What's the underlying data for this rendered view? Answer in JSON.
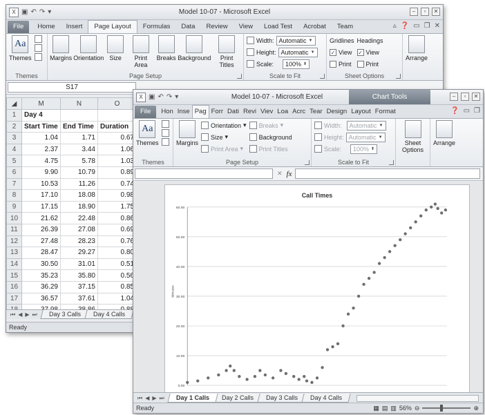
{
  "back_window": {
    "title": "Model 10-07 - Microsoft Excel",
    "tabs": [
      "File",
      "Home",
      "Insert",
      "Page Layout",
      "Formulas",
      "Data",
      "Review",
      "View",
      "Load Test",
      "Acrobat",
      "Team"
    ],
    "active_tab": "Page Layout",
    "ribbon": {
      "themes": {
        "button": "Themes",
        "label": "Themes"
      },
      "page_setup": {
        "buttons": [
          "Margins",
          "Orientation",
          "Size",
          "Print Area",
          "Breaks",
          "Background",
          "Print Titles"
        ],
        "label": "Page Setup"
      },
      "scale": {
        "width_label": "Width:",
        "width_value": "Automatic",
        "height_label": "Height:",
        "height_value": "Automatic",
        "scale_label": "Scale:",
        "scale_value": "100%",
        "label": "Scale to Fit"
      },
      "sheet_options": {
        "gridlines": "Gridlines",
        "headings": "Headings",
        "view": "View",
        "print": "Print",
        "label": "Sheet Options"
      },
      "arrange": {
        "button": "Arrange"
      }
    },
    "name_box": "S17",
    "columns": [
      "M",
      "N",
      "O"
    ],
    "rows": [
      {
        "n": "1",
        "cells": [
          "Day 4",
          "",
          ""
        ]
      },
      {
        "n": "2",
        "cells": [
          "Start Time",
          "End Time",
          "Duration"
        ]
      },
      {
        "n": "3",
        "cells": [
          "1.04",
          "1.71",
          "0.67"
        ]
      },
      {
        "n": "4",
        "cells": [
          "2.37",
          "3.44",
          "1.06"
        ]
      },
      {
        "n": "5",
        "cells": [
          "4.75",
          "5.78",
          "1.03"
        ]
      },
      {
        "n": "6",
        "cells": [
          "9.90",
          "10.79",
          "0.89"
        ]
      },
      {
        "n": "7",
        "cells": [
          "10.53",
          "11.26",
          "0.74"
        ]
      },
      {
        "n": "8",
        "cells": [
          "17.10",
          "18.08",
          "0.98"
        ]
      },
      {
        "n": "9",
        "cells": [
          "17.15",
          "18.90",
          "1.75"
        ]
      },
      {
        "n": "10",
        "cells": [
          "21.62",
          "22.48",
          "0.86"
        ]
      },
      {
        "n": "11",
        "cells": [
          "26.39",
          "27.08",
          "0.69"
        ]
      },
      {
        "n": "12",
        "cells": [
          "27.48",
          "28.23",
          "0.76"
        ]
      },
      {
        "n": "13",
        "cells": [
          "28.47",
          "29.27",
          "0.80"
        ]
      },
      {
        "n": "14",
        "cells": [
          "30.50",
          "31.01",
          "0.51"
        ]
      },
      {
        "n": "15",
        "cells": [
          "35.23",
          "35.80",
          "0.56"
        ]
      },
      {
        "n": "16",
        "cells": [
          "36.29",
          "37.15",
          "0.85"
        ]
      },
      {
        "n": "17",
        "cells": [
          "36.57",
          "37.61",
          "1.04"
        ]
      },
      {
        "n": "18",
        "cells": [
          "37.98",
          "38.86",
          "0.88"
        ]
      }
    ],
    "sheet_tabs": [
      "Day 3 Calls",
      "Day 4 Calls"
    ],
    "status": "Ready"
  },
  "front_window": {
    "title": "Model 10-07 - Microsoft Excel",
    "chart_tools": "Chart Tools",
    "tabs": [
      "File",
      "Hon",
      "Inse",
      "Pag",
      "Forr",
      "Dati",
      "Revi",
      "Viev",
      "Loa",
      "Acrc",
      "Tear",
      "Design",
      "Layout",
      "Format"
    ],
    "active_tab": "Pag",
    "ribbon": {
      "themes": {
        "button": "Themes",
        "label": "Themes"
      },
      "margins": "Margins",
      "orientation": "Orientation",
      "size": "Size",
      "print_area": "Print Area",
      "breaks": "Breaks",
      "background": "Background",
      "print_titles": "Print Titles",
      "page_setup_label": "Page Setup",
      "width_label": "Width:",
      "width_value": "Automatic",
      "height_label": "Height:",
      "height_value": "Automatic",
      "scale_label": "Scale:",
      "scale_value": "100%",
      "scale_group_label": "Scale to Fit",
      "sheet_options": "Sheet Options",
      "arrange": "Arrange"
    },
    "formula_fx": "fx",
    "sheet_tabs": [
      "Day 1 Calls",
      "Day 2 Calls",
      "Day 3 Calls",
      "Day 4 Calls"
    ],
    "active_sheet": "Day 1 Calls",
    "status": "Ready",
    "zoom": "56%"
  },
  "chart_data": {
    "type": "scatter",
    "title": "Call Times",
    "ylabel": "Minutes",
    "xlabel": "",
    "y_ticks": [
      "0.00",
      "10.00",
      "20.00",
      "30.00",
      "40.00",
      "50.00",
      "60.00"
    ],
    "ylim": [
      0,
      60
    ],
    "xlim": [
      0,
      1000
    ],
    "grid": true,
    "color": "#6e6e6e",
    "points": [
      [
        0,
        1
      ],
      [
        40,
        1.5
      ],
      [
        80,
        2.5
      ],
      [
        120,
        3.5
      ],
      [
        150,
        5
      ],
      [
        165,
        6.5
      ],
      [
        180,
        5
      ],
      [
        200,
        3
      ],
      [
        230,
        2
      ],
      [
        260,
        3
      ],
      [
        280,
        5
      ],
      [
        300,
        3.5
      ],
      [
        330,
        2.5
      ],
      [
        360,
        5
      ],
      [
        380,
        4
      ],
      [
        410,
        3
      ],
      [
        430,
        2
      ],
      [
        450,
        3
      ],
      [
        460,
        1.5
      ],
      [
        480,
        1
      ],
      [
        500,
        2.5
      ],
      [
        520,
        6
      ],
      [
        540,
        12
      ],
      [
        560,
        13
      ],
      [
        580,
        14
      ],
      [
        600,
        20
      ],
      [
        620,
        24
      ],
      [
        640,
        26
      ],
      [
        660,
        30
      ],
      [
        680,
        34
      ],
      [
        700,
        36
      ],
      [
        720,
        38
      ],
      [
        740,
        41
      ],
      [
        760,
        43
      ],
      [
        780,
        45
      ],
      [
        800,
        47
      ],
      [
        820,
        49
      ],
      [
        840,
        51
      ],
      [
        860,
        53
      ],
      [
        880,
        55
      ],
      [
        900,
        57
      ],
      [
        920,
        59
      ],
      [
        940,
        60
      ],
      [
        955,
        61
      ],
      [
        965,
        59.5
      ],
      [
        980,
        58
      ],
      [
        995,
        59
      ]
    ]
  }
}
